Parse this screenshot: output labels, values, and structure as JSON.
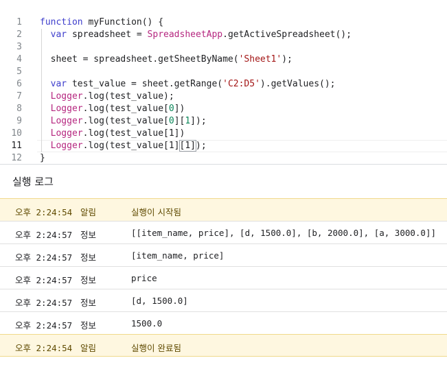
{
  "editor": {
    "lines": [
      {
        "num": "1",
        "parts": [
          [
            "fn-kw",
            "function"
          ],
          [
            "",
            "  myFunction() {"
          ]
        ]
      },
      {
        "num": "2",
        "parts": [
          [
            "",
            "  "
          ],
          [
            "fn-kw",
            "var"
          ],
          [
            "",
            " spreadsheet = "
          ],
          [
            "cls",
            "SpreadsheetApp"
          ],
          [
            "",
            ".getActiveSpreadsheet();"
          ]
        ]
      },
      {
        "num": "3",
        "parts": []
      },
      {
        "num": "4",
        "parts": [
          [
            "",
            "  sheet = spreadsheet.getSheetByName("
          ],
          [
            "str",
            "'Sheet1'"
          ],
          [
            "",
            ");"
          ]
        ]
      },
      {
        "num": "5",
        "parts": []
      },
      {
        "num": "6",
        "parts": [
          [
            "",
            "  "
          ],
          [
            "fn-kw",
            "var"
          ],
          [
            "",
            " test_value = sheet.getRange("
          ],
          [
            "str",
            "'C2:D5'"
          ],
          [
            "",
            ").getValues();"
          ]
        ]
      },
      {
        "num": "7",
        "parts": [
          [
            "",
            "  "
          ],
          [
            "logger",
            "Logger"
          ],
          [
            "",
            ".log(test_value);"
          ]
        ]
      },
      {
        "num": "8",
        "parts": [
          [
            "",
            "  "
          ],
          [
            "logger",
            "Logger"
          ],
          [
            "",
            ".log(test_value["
          ],
          [
            "num",
            "0"
          ],
          [
            "",
            "])"
          ]
        ]
      },
      {
        "num": "9",
        "parts": [
          [
            "",
            "  "
          ],
          [
            "logger",
            "Logger"
          ],
          [
            "",
            ".log(test_value["
          ],
          [
            "num",
            "0"
          ],
          [
            "",
            "]["
          ],
          [
            "num",
            "1"
          ],
          [
            "",
            "]);"
          ]
        ]
      },
      {
        "num": "10",
        "parts": [
          [
            "",
            "  "
          ],
          [
            "logger",
            "Logger"
          ],
          [
            "",
            ".log(test_value[1])"
          ]
        ]
      },
      {
        "num": "11",
        "parts": [
          [
            "",
            "  "
          ],
          [
            "logger",
            "Logger"
          ],
          [
            "",
            ".log(test_value[1]"
          ],
          [
            "cursor",
            "[1]"
          ],
          [
            "",
            ");"
          ]
        ]
      },
      {
        "num": "12",
        "parts": [
          [
            "",
            "}"
          ]
        ]
      }
    ]
  },
  "log": {
    "title": "실행 로그",
    "rows": [
      {
        "time": "오후 2:24:54",
        "level": "알림",
        "message": "실행이 시작됨",
        "kind": "notice",
        "msg_kr": true
      },
      {
        "time": "오후 2:24:57",
        "level": "정보",
        "message": "[[item_name, price], [d, 1500.0], [b, 2000.0], [a, 3000.0]]",
        "kind": "info",
        "msg_kr": false
      },
      {
        "time": "오후 2:24:57",
        "level": "정보",
        "message": "[item_name, price]",
        "kind": "info",
        "msg_kr": false
      },
      {
        "time": "오후 2:24:57",
        "level": "정보",
        "message": "price",
        "kind": "info",
        "msg_kr": false
      },
      {
        "time": "오후 2:24:57",
        "level": "정보",
        "message": "[d, 1500.0]",
        "kind": "info",
        "msg_kr": false
      },
      {
        "time": "오후 2:24:57",
        "level": "정보",
        "message": "1500.0",
        "kind": "info",
        "msg_kr": false
      },
      {
        "time": "오후 2:24:54",
        "level": "알림",
        "message": "실행이 완료됨",
        "kind": "notice",
        "msg_kr": true
      }
    ]
  },
  "colors": {
    "notice_bg": "#fef7e0",
    "keyword": "#3d3dcc",
    "class_and_logger": "#b5267f",
    "string": "#a31515"
  }
}
